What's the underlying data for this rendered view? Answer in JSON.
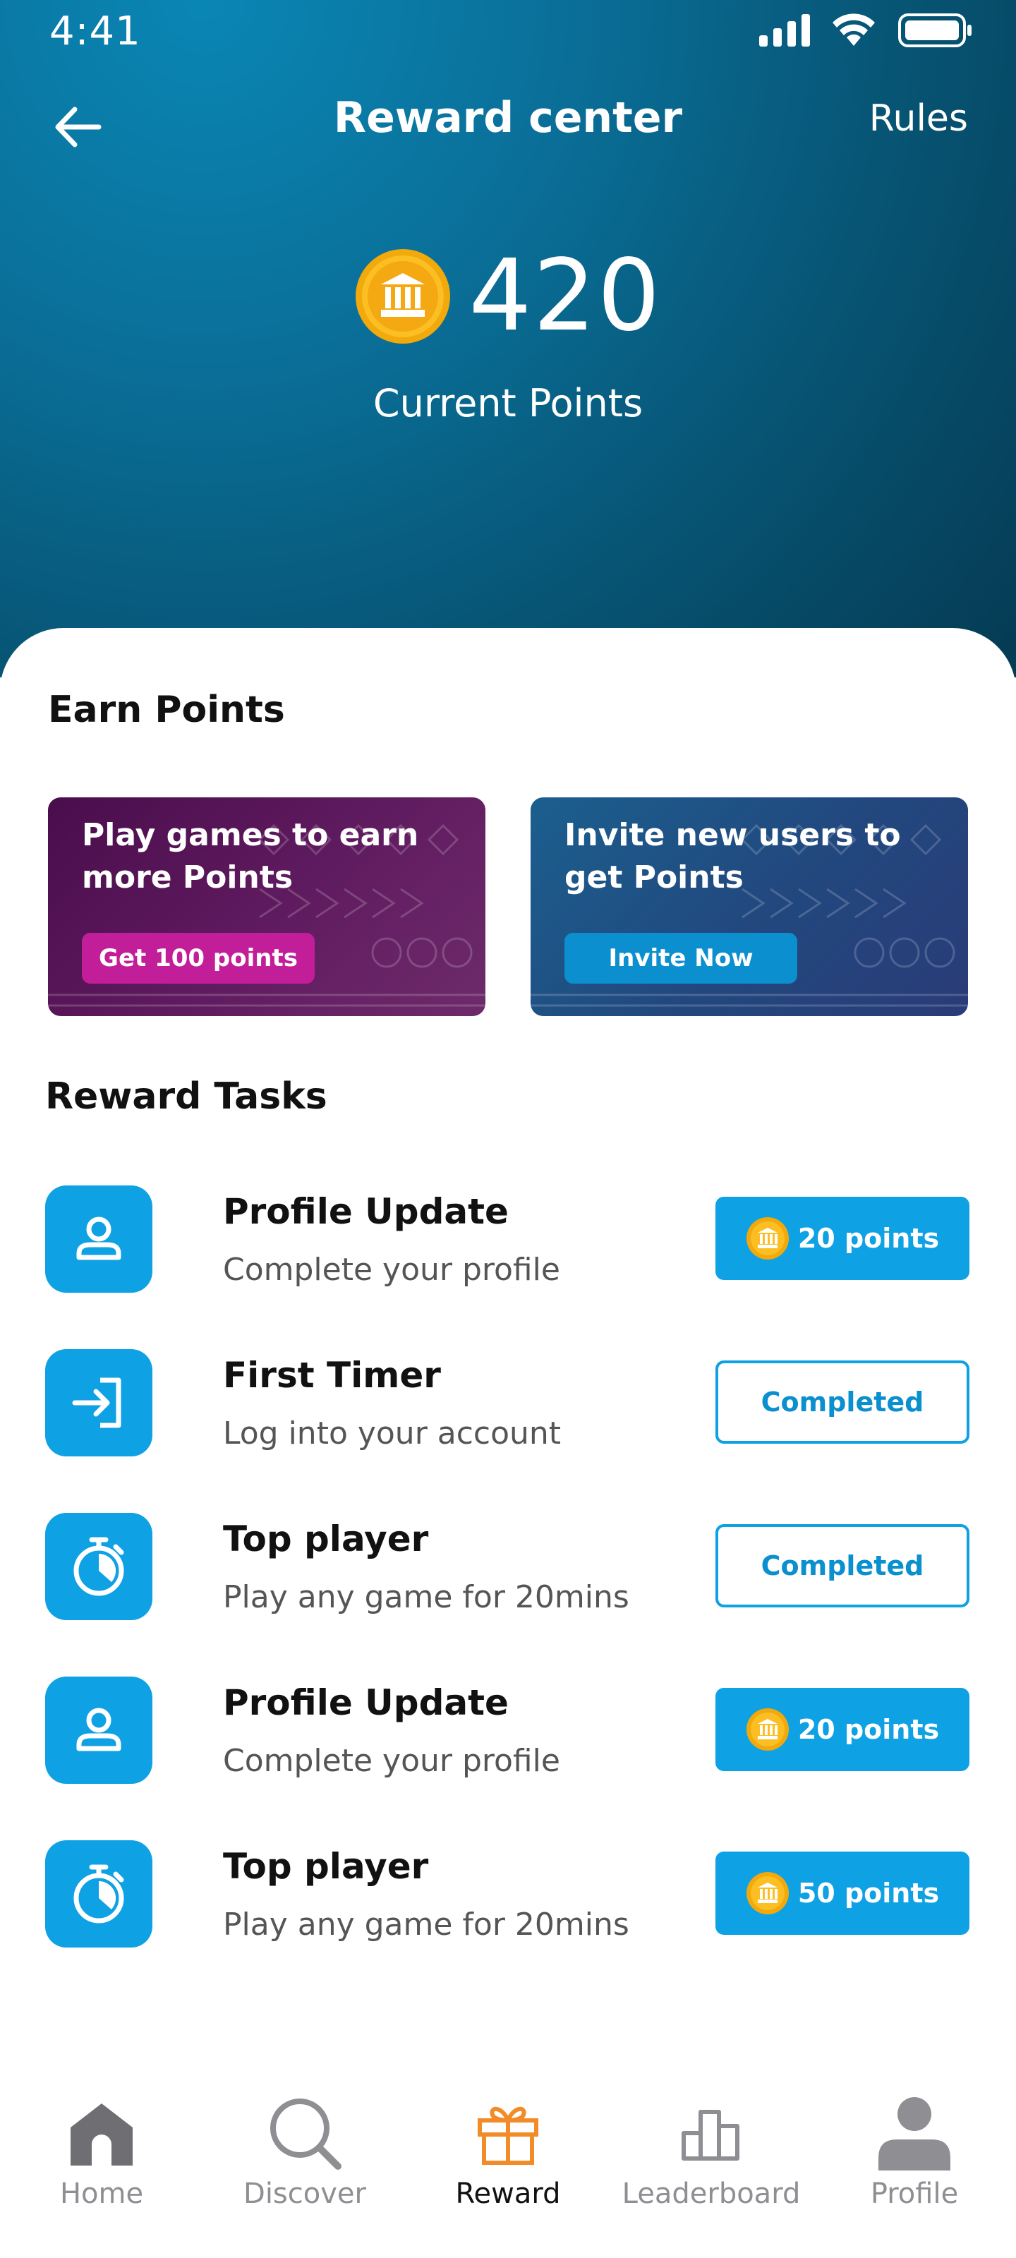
{
  "status_bar": {
    "time": "4:41"
  },
  "header": {
    "title": "Reward center",
    "rules_label": "Rules"
  },
  "points": {
    "value": "420",
    "caption": "Current Points"
  },
  "earn_section": {
    "title": "Earn Points",
    "cards": [
      {
        "text": "Play games to earn more Points",
        "button": "Get 100 points"
      },
      {
        "text": "Invite new users to get Points",
        "button": "Invite Now"
      }
    ]
  },
  "tasks_section": {
    "title": "Reward Tasks",
    "tasks": [
      {
        "title": "Profile Update",
        "subtitle": "Complete your profile",
        "icon": "user-icon",
        "action": "20 points",
        "status": "points"
      },
      {
        "title": "First Timer",
        "subtitle": "Log into your account",
        "icon": "login-icon",
        "action": "Completed",
        "status": "completed"
      },
      {
        "title": "Top player",
        "subtitle": "Play any game for 20mins",
        "icon": "stopwatch-icon",
        "action": "Completed",
        "status": "completed"
      },
      {
        "title": "Profile Update",
        "subtitle": "Complete your profile",
        "icon": "user-icon",
        "action": "20 points",
        "status": "points"
      },
      {
        "title": "Top player",
        "subtitle": "Play any game for 20mins",
        "icon": "stopwatch-icon",
        "action": "50 points",
        "status": "points"
      }
    ]
  },
  "bottom_nav": {
    "items": [
      {
        "label": "Home",
        "icon": "home-icon",
        "active": false
      },
      {
        "label": "Discover",
        "icon": "search-icon",
        "active": false
      },
      {
        "label": "Reward",
        "icon": "gift-icon",
        "active": true
      },
      {
        "label": "Leaderboard",
        "icon": "leaderboard-icon",
        "active": false
      },
      {
        "label": "Profile",
        "icon": "profile-icon",
        "active": false
      }
    ]
  },
  "colors": {
    "accent": "#0ea1e4",
    "header_dark": "#053a52",
    "magenta": "#c21e9a",
    "nav_active": "#f28c28",
    "nav_inactive": "#8e8e93"
  }
}
